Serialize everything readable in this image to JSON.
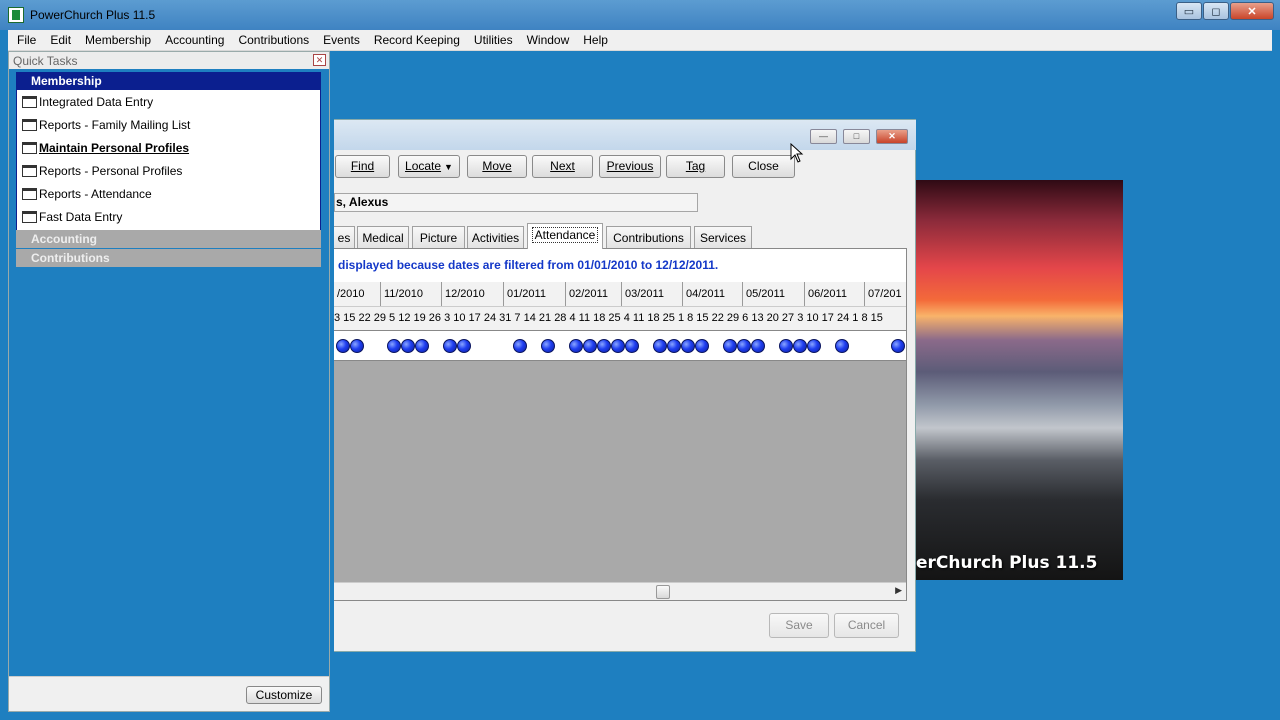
{
  "app": {
    "title": "PowerChurch Plus 11.5"
  },
  "window_controls": {
    "minimize": "▭",
    "maximize": "◻",
    "close": "✕"
  },
  "menu": [
    "File",
    "Edit",
    "Membership",
    "Accounting",
    "Contributions",
    "Events",
    "Record Keeping",
    "Utilities",
    "Window",
    "Help"
  ],
  "quick_tasks": {
    "title": "Quick Tasks",
    "close": "✕",
    "sections": {
      "membership": "Membership",
      "accounting": "Accounting",
      "contributions": "Contributions"
    },
    "links": [
      "Integrated Data Entry",
      "Reports - Family Mailing List",
      "Maintain Personal Profiles",
      "Reports - Personal Profiles",
      "Reports - Attendance",
      "Fast Data Entry"
    ],
    "customize": "Customize"
  },
  "splash": {
    "text": "erChurch Plus 11.5"
  },
  "dialog": {
    "controls": {
      "minimize": "—",
      "maximize": "□",
      "close": "✕"
    },
    "toolbar": {
      "find": "Find",
      "locate": "Locate",
      "move": "Move",
      "next": "Next",
      "previous": "Previous",
      "tag": "Tag",
      "close": "Close"
    },
    "name_value": "s, Alexus",
    "tabs": [
      "es",
      "Medical",
      "Picture",
      "Activities",
      "Attendance",
      "Contributions",
      "Services"
    ],
    "active_tab": "Attendance",
    "filter_notice": "displayed because dates are filtered from 01/01/2010 to 12/12/2011.",
    "months": [
      "/2010",
      "11/2010",
      "12/2010",
      "01/2011",
      "02/2011",
      "03/2011",
      "04/2011",
      "05/2011",
      "06/2011",
      "07/201"
    ],
    "days": "3 15 22 29  5  12 19 26  3  10 17 24 31  7  14 21 28  4  11 18 25  4  11 18 25  1   8  15 22 29  6  13 20 27  3  10 17 24  1   8  15",
    "attendance_dot_count": 28,
    "save": "Save",
    "cancel": "Cancel"
  }
}
